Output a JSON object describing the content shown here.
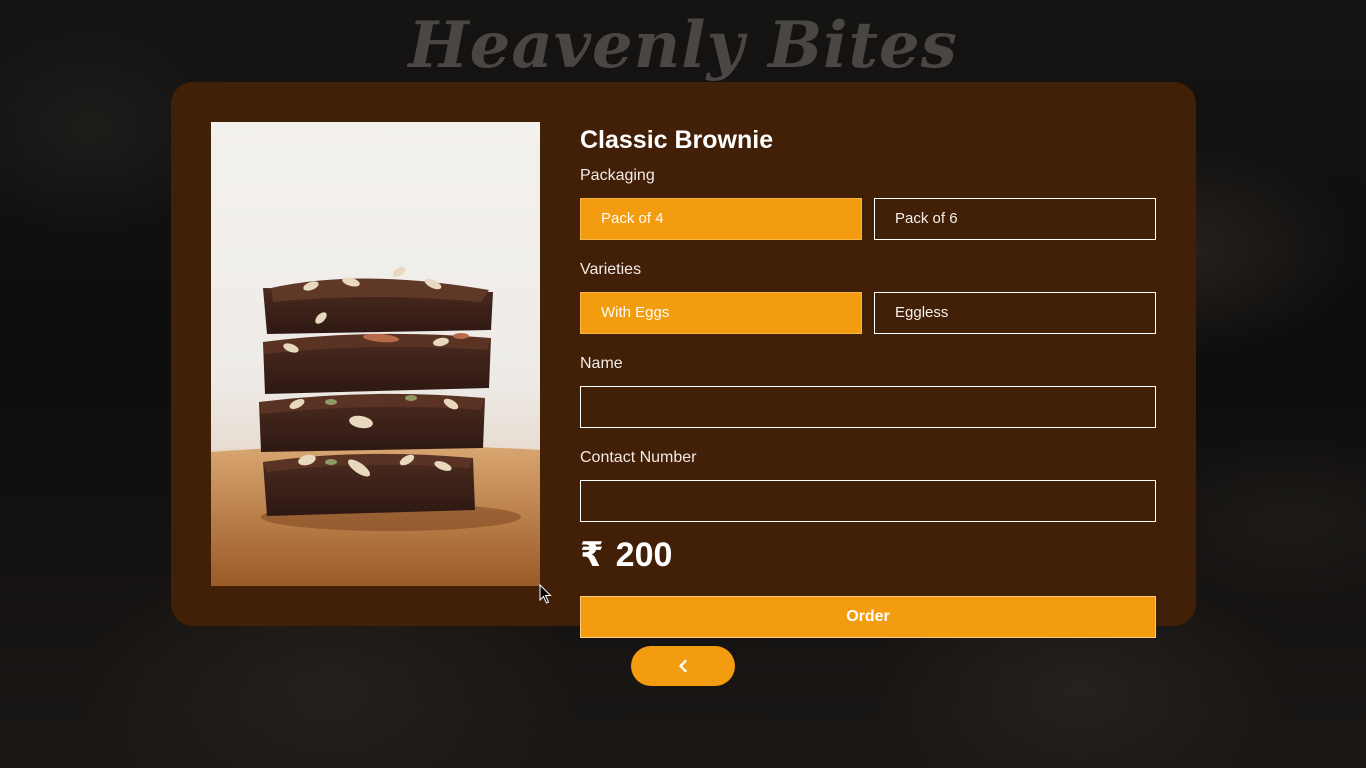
{
  "brand": {
    "title": "Heavenly Bites"
  },
  "product": {
    "name": "Classic Brownie",
    "image_alt": "Stack of four almond-topped brownies on a wooden board"
  },
  "packaging": {
    "label": "Packaging",
    "options": [
      "Pack of 4",
      "Pack of 6"
    ],
    "selected": "Pack of 4"
  },
  "varieties": {
    "label": "Varieties",
    "options": [
      "With Eggs",
      "Eggless"
    ],
    "selected": "With Eggs"
  },
  "name_field": {
    "label": "Name",
    "value": ""
  },
  "contact_field": {
    "label": "Contact Number",
    "value": ""
  },
  "price": {
    "currency": "₹",
    "amount": "200"
  },
  "actions": {
    "order_label": "Order",
    "back_icon": "chevron-left-icon"
  },
  "colors": {
    "accent": "#f39c0f",
    "card": "#421f07",
    "background": "#0d0c0b"
  }
}
